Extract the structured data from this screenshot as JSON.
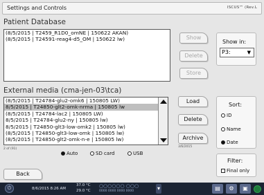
{
  "window": {
    "title": "Settings and Controls",
    "brand": "ISCUS™ (Rev.L"
  },
  "patient_db": {
    "title": "Patient Database",
    "rows": [
      "(8/5/2015 | T2459_R1D0_omNE | 150622 AKAN)",
      "(8/5/2015 | T24591-reag4-d5_OM | 150622 lw)"
    ],
    "buttons": {
      "show": "Show",
      "delete": "Delete",
      "store": "Store"
    },
    "show_in": {
      "label": "Show in:",
      "value": "P3:",
      "arrow": "▼"
    }
  },
  "external": {
    "title": "External media (cma-jen-03\\tca)",
    "rows": [
      "(8/5/2015 | T24784-glu2-omk6 | 150805 LW)",
      "8/5/2015 | T24850-glt2-omk-nrma | 150805 lw",
      "(8/5/2015 | T24784-lac2 | 150805 LW)",
      "8/5/2015 | T24784-glu2-ny | 150805 lw)",
      "8/5/2015 | T24850-glt3-low-omk2 | 150805 lw)",
      "(8/5/2015 | T24850-glt3-low-omk | 150805 lw)",
      "(8/5/2015 | T24850-glt2-omk-n-e | 150805 lw)"
    ],
    "selected_index": 1,
    "count": "2 of (91)",
    "source_options": [
      "Auto",
      "SD card",
      "USB"
    ],
    "source_selected": "Auto",
    "buttons": {
      "load": "Load",
      "delete": "Delete",
      "archive": "Archive"
    },
    "archive_date": "3/6/2015"
  },
  "sort": {
    "label": "Sort:",
    "options": [
      "ID",
      "Name",
      "Date"
    ],
    "selected": "Date"
  },
  "filter": {
    "label": "Filter:",
    "final_only": "Final only",
    "checked": false
  },
  "back": "Back",
  "taskbar": {
    "datetime": "8/6/2015 8:26 AM",
    "temp1": "37.0 °C",
    "temp2": "29.0 °C",
    "slots_dim": "○○○○○○ ○○○",
    "slots": "0000 0000 0000 0000"
  },
  "colors": {
    "taskbar": "#1b2433",
    "selected_row": "#bfbfbf"
  }
}
